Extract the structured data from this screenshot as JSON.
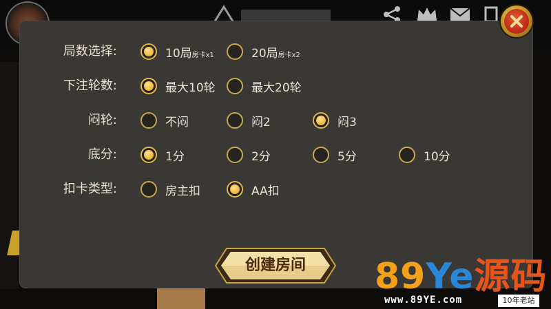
{
  "options_rows": [
    {
      "label": "局数选择:",
      "options": [
        {
          "main": "10局",
          "sub": "房卡x1",
          "selected": true
        },
        {
          "main": "20局",
          "sub": "房卡x2",
          "selected": false
        }
      ]
    },
    {
      "label": "下注轮数:",
      "options": [
        {
          "main": "最大10轮",
          "sub": "",
          "selected": true
        },
        {
          "main": "最大20轮",
          "sub": "",
          "selected": false
        }
      ]
    },
    {
      "label": "闷轮:",
      "options": [
        {
          "main": "不闷",
          "sub": "",
          "selected": false
        },
        {
          "main": "闷2",
          "sub": "",
          "selected": false
        },
        {
          "main": "闷3",
          "sub": "",
          "selected": true
        }
      ]
    },
    {
      "label": "底分:",
      "options": [
        {
          "main": "1分",
          "sub": "",
          "selected": true
        },
        {
          "main": "2分",
          "sub": "",
          "selected": false
        },
        {
          "main": "5分",
          "sub": "",
          "selected": false
        },
        {
          "main": "10分",
          "sub": "",
          "selected": false
        }
      ]
    },
    {
      "label": "扣卡类型:",
      "options": [
        {
          "main": "房主扣",
          "sub": "",
          "selected": false
        },
        {
          "main": "AA扣",
          "sub": "",
          "selected": true
        }
      ]
    }
  ],
  "create_button": "创建房间",
  "watermark": {
    "brand": "89Ye源码",
    "url": "www.89YE.com",
    "tag": "10年老站"
  },
  "icons": [
    "share-icon",
    "crown-icon",
    "mail-icon",
    "close-icon"
  ],
  "colors": {
    "accent_gold": "#f0b43a",
    "panel": "#3a3835",
    "close_red": "#b9281a"
  }
}
